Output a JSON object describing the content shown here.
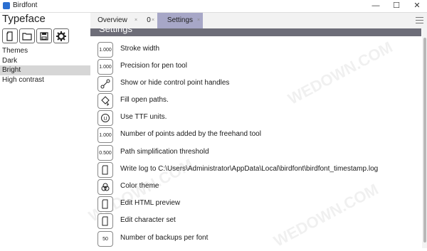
{
  "window": {
    "title": "Birdfont",
    "controls": {
      "minimize": "—",
      "maximize": "☐",
      "close": "✕"
    }
  },
  "left_panel": {
    "title": "Typeface",
    "toolbar_icons": [
      "file-icon",
      "folder-icon",
      "save-icon",
      "gear-icon"
    ],
    "themes": [
      "Themes",
      "Dark",
      "Bright",
      "High contrast"
    ],
    "selected_theme": "Bright"
  },
  "tabs": [
    {
      "label": "Overview",
      "active": false
    },
    {
      "label": "0",
      "active": false
    },
    {
      "label": "Settings",
      "active": true
    }
  ],
  "tab_close_glyph": "×",
  "content": {
    "section_title": "Settings",
    "rows": [
      {
        "icon": "1.000",
        "icon_name": "number-field-icon",
        "label": "Stroke width"
      },
      {
        "icon": "1.000",
        "icon_name": "number-field-icon",
        "label": "Precision for pen tool"
      },
      {
        "icon": "",
        "icon_name": "control-handles-icon",
        "label": "Show or hide control point handles"
      },
      {
        "icon": "",
        "icon_name": "fill-paths-icon",
        "label": "Fill open paths."
      },
      {
        "icon": "U",
        "icon_name": "ttf-units-icon",
        "label": "Use TTF units."
      },
      {
        "icon": "1.000",
        "icon_name": "number-field-icon",
        "label": "Number of points added by the freehand tool"
      },
      {
        "icon": "0.500",
        "icon_name": "number-field-icon",
        "label": "Path simplification threshold"
      },
      {
        "icon": "",
        "icon_name": "file-icon",
        "label": "Write log to C:\\Users\\Administrator\\AppData\\Local\\birdfont\\birdfont_timestamp.log"
      },
      {
        "icon": "",
        "icon_name": "color-theme-icon",
        "label": "Color theme"
      },
      {
        "icon": "",
        "icon_name": "file-icon",
        "label": "Edit HTML preview"
      },
      {
        "icon": "",
        "icon_name": "file-icon",
        "label": "Edit character set"
      },
      {
        "icon": "50",
        "icon_name": "number-field-icon",
        "label": "Number of backups per font"
      }
    ]
  },
  "watermark": "WEDOWN.COM",
  "colors": {
    "tab_active": "#a7a7c7",
    "section_header": "#6d6d78",
    "selected_item": "#d6d6d6"
  }
}
